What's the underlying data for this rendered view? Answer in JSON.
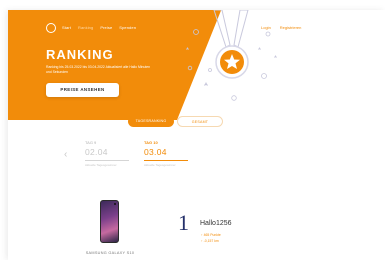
{
  "hero": {
    "nav_items": [
      "Start",
      "Ranking",
      "Preise",
      "Spenden"
    ],
    "title": "RANKING",
    "subtitle": "Ranking bis 25.03.2022 bis 03.04.2022 Aktualisiert alle Hallo Minuten und Sekunden",
    "cta_label": "PREISE ANSEHEN",
    "right_nav": [
      "Login",
      "Registrieren"
    ]
  },
  "tabs": [
    {
      "label": "TAGESRANKING",
      "active": true
    },
    {
      "label": "GESAMT",
      "active": false
    }
  ],
  "days": [
    {
      "label": "TAG 9",
      "value": "02.04",
      "note": "Aktuelle Tagesgewinner",
      "active": false
    },
    {
      "label": "TAG 10",
      "value": "03.04",
      "note": "Aktuelle Tagesgewinner",
      "active": true
    }
  ],
  "prize": {
    "product": "SAMSUNG GALAXY S10"
  },
  "leader": {
    "rank": "1",
    "username": "Hallo1256",
    "stat1": "↑ 465 Punkte",
    "stat2": "↑ -0,157 km"
  },
  "colors": {
    "accent": "#f28c0a",
    "rank_number": "#24306a"
  }
}
